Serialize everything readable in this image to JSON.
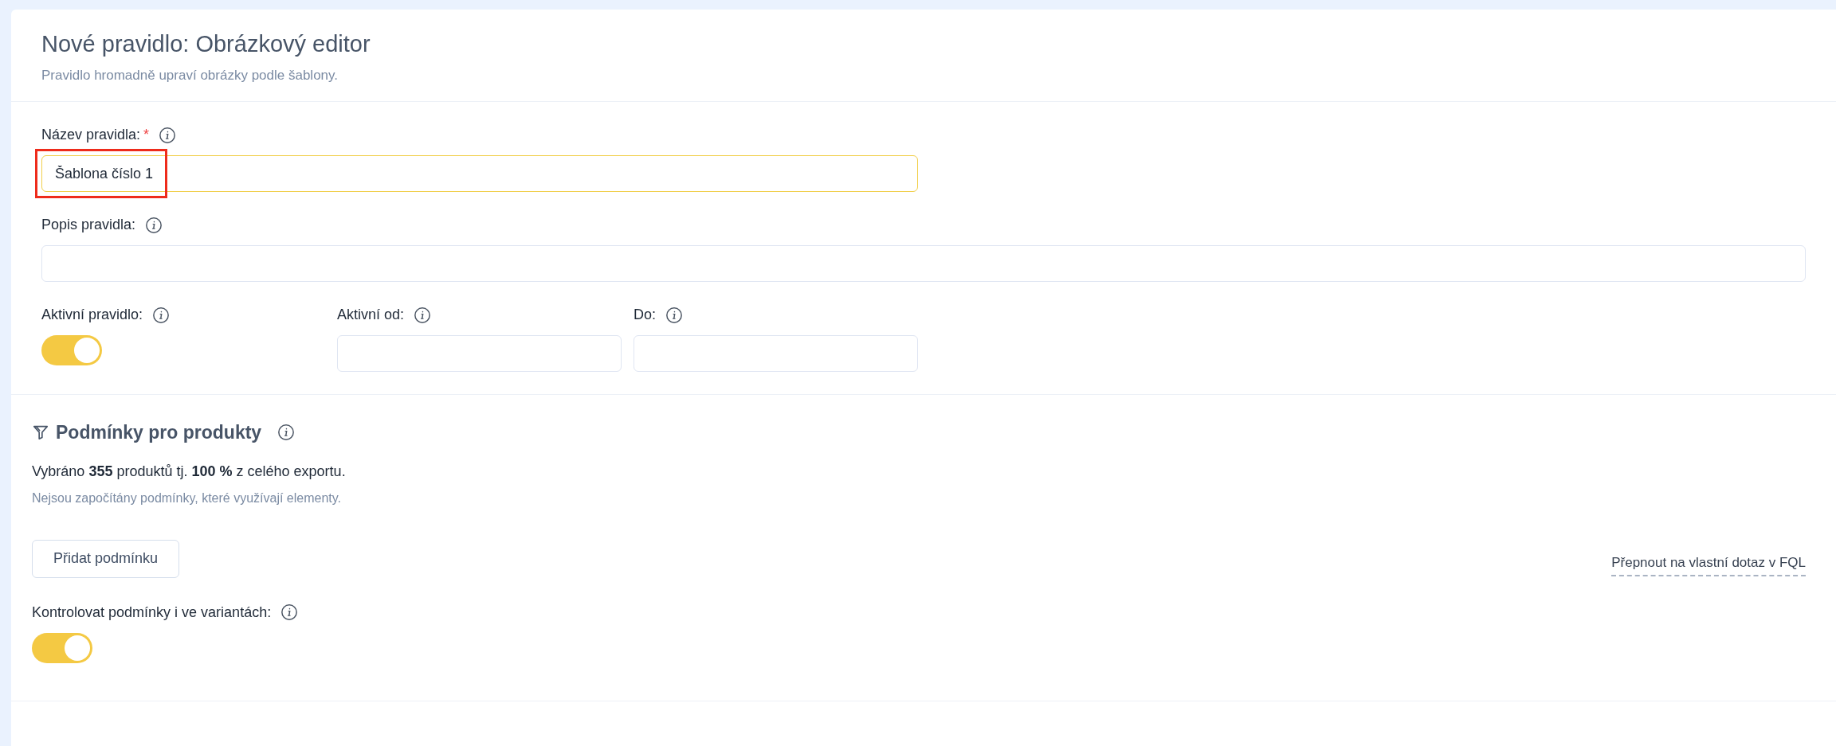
{
  "header": {
    "title": "Nové pravidlo: Obrázkový editor",
    "subtitle": "Pravidlo hromadně upraví obrázky podle šablony."
  },
  "name_field": {
    "label": "Název pravidla:",
    "required_mark": "*",
    "value": "Šablona číslo 1",
    "highlighted": true
  },
  "description_field": {
    "label": "Popis pravidla:"
  },
  "active_rule": {
    "label": "Aktivní pravidlo:",
    "on": true
  },
  "active_from": {
    "label": "Aktivní od:"
  },
  "active_to": {
    "label": "Do:"
  },
  "conditions": {
    "title": "Podmínky pro produkty",
    "summary": "Vybráno **355** produktů tj. **100 %** z celého exportu.",
    "note": "Nejsou započítány podmínky, které využívají elementy.",
    "add_button": "Přidat podmínku",
    "fql_link": "Přepnout na vlastní dotaz v FQL"
  },
  "variants": {
    "label": "Kontrolovat podmínky i ve variantách:",
    "on": true
  }
}
